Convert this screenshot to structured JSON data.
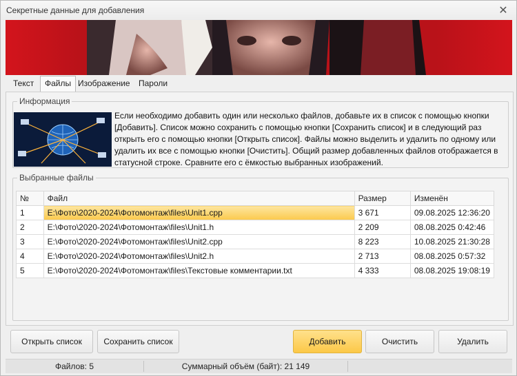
{
  "window": {
    "title": "Секретные данные для добавления",
    "close_label": "✕"
  },
  "tabs": [
    {
      "label": "Текст",
      "active": false
    },
    {
      "label": "Файлы",
      "active": true
    },
    {
      "label": "Изображение",
      "active": false
    },
    {
      "label": "Пароли",
      "active": false
    }
  ],
  "info": {
    "legend": "Информация",
    "text": "Если необходимо добавить один или несколько файлов, добавьте их в список с помощью кнопки [Добавить]. Список можно сохранить с помощью кнопки [Сохранить список] и в следующий раз открыть его с помощью кнопки [Открыть список]. Файлы можно выделить и удалить по одному или удалить их все с помощью кнопки [Очистить]. Общий размер добавленных файлов отображается в статусной строке. Сравните его с ёмкостью выбранных изображений."
  },
  "files": {
    "legend": "Выбранные файлы",
    "columns": [
      "№",
      "Файл",
      "Размер",
      "Изменён"
    ],
    "rows": [
      {
        "num": "1",
        "file": "E:\\Фото\\2020-2024\\Фотомонтаж\\files\\Unit1.cpp",
        "size": "3 671",
        "modified": "09.08.2025 12:36:20",
        "selected": true
      },
      {
        "num": "2",
        "file": "E:\\Фото\\2020-2024\\Фотомонтаж\\files\\Unit1.h",
        "size": "2 209",
        "modified": "08.08.2025 0:42:46",
        "selected": false
      },
      {
        "num": "3",
        "file": "E:\\Фото\\2020-2024\\Фотомонтаж\\files\\Unit2.cpp",
        "size": "8 223",
        "modified": "10.08.2025 21:30:28",
        "selected": false
      },
      {
        "num": "4",
        "file": "E:\\Фото\\2020-2024\\Фотомонтаж\\files\\Unit2.h",
        "size": "2 713",
        "modified": "08.08.2025 0:57:32",
        "selected": false
      },
      {
        "num": "5",
        "file": "E:\\Фото\\2020-2024\\Фотомонтаж\\files\\Текстовые комментарии.txt",
        "size": "4 333",
        "modified": "08.08.2025 19:08:19",
        "selected": false
      }
    ]
  },
  "buttons": {
    "open_list": "Открыть список",
    "save_list": "Сохранить список",
    "add": "Добавить",
    "clear": "Очистить",
    "delete": "Удалить"
  },
  "status": {
    "files_count": "Файлов: 5",
    "total_size": "Суммарный объём (байт): 21 149"
  },
  "colors": {
    "banner_red": "#c8161e",
    "selection": "#fcc94c",
    "primary_button": "#fcc847"
  }
}
